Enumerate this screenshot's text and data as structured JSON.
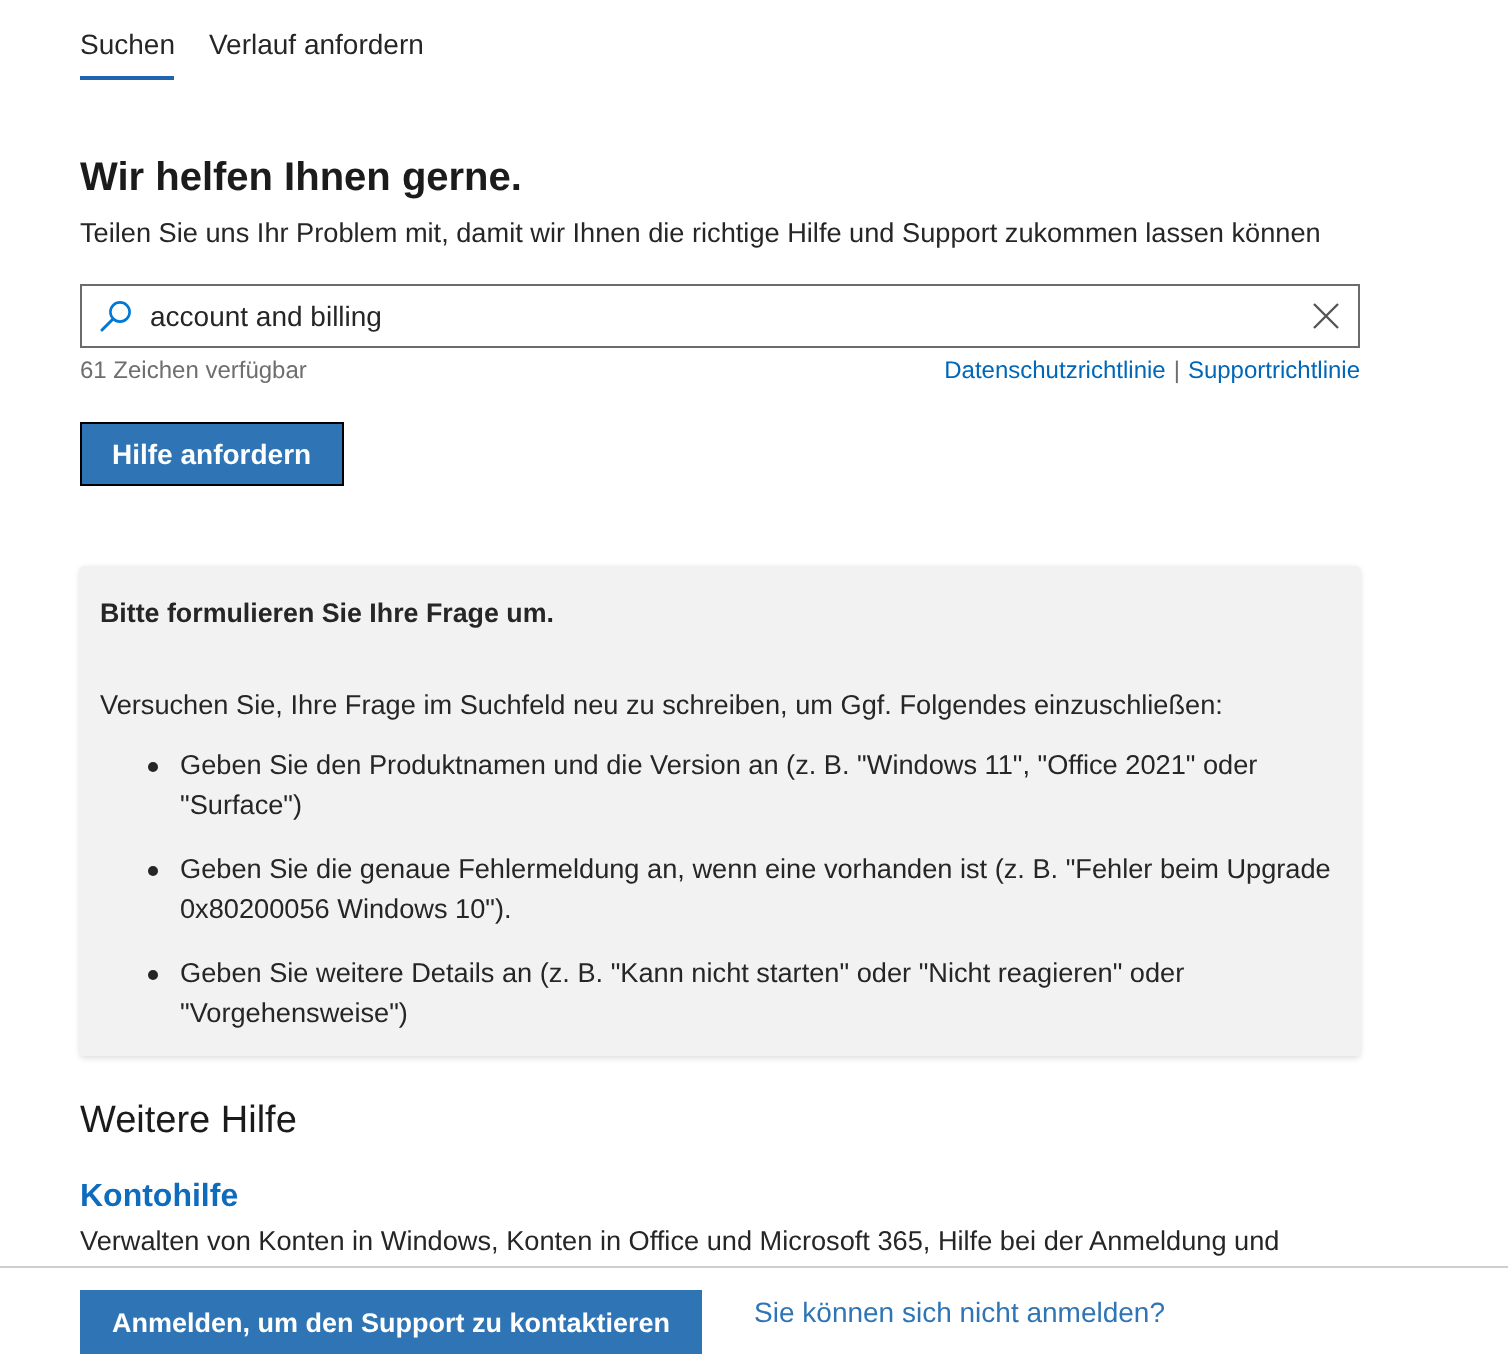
{
  "tabs": [
    {
      "label": "Suchen",
      "selected": true
    },
    {
      "label": "Verlauf anfordern",
      "selected": false
    }
  ],
  "header": {
    "title": "Wir helfen Ihnen gerne.",
    "subtitle": "Teilen Sie uns Ihr Problem mit, damit wir Ihnen die richtige Hilfe und Support zukommen lassen können"
  },
  "search": {
    "value": "account and billing",
    "counter": "61 Zeichen verfügbar",
    "links": [
      "Datenschutzrichtlinie",
      "Supportrichtlinie"
    ],
    "separator": "|"
  },
  "submit_button": "Hilfe anfordern",
  "notice": {
    "title": "Bitte formulieren Sie Ihre Frage um.",
    "intro": "Versuchen Sie, Ihre Frage im Suchfeld neu zu schreiben, um Ggf. Folgendes einzuschließen:",
    "tips": [
      "Geben Sie den Produktnamen und die Version an (z. B. \"Windows 11\", \"Office 2021\" oder \"Surface\")",
      "Geben Sie die genaue Fehlermeldung an, wenn eine vorhanden ist (z. B. \"Fehler beim Upgrade 0x80200056 Windows 10\").",
      "Geben Sie weitere Details an (z. B. \"Kann nicht starten\" oder \"Nicht reagieren\" oder \"Vorgehensweise\")"
    ]
  },
  "more_help": {
    "title": "Weitere Hilfe",
    "items": [
      {
        "title": "Kontohilfe",
        "description": "Verwalten von Konten in Windows, Konten in Office und Microsoft 365, Hilfe bei der Anmeldung und"
      }
    ]
  },
  "footer": {
    "button": "Anmelden, um den Support zu kontaktieren",
    "link": "Sie können sich nicht anmelden?"
  }
}
